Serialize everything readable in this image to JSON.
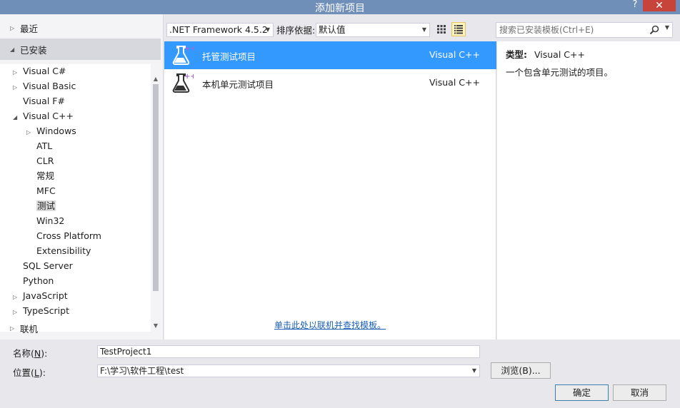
{
  "window": {
    "title": "添加新项目",
    "help_label": "?",
    "close_label": "✕"
  },
  "left": {
    "recent_label": "最近",
    "installed_label": "已安装",
    "online_label": "联机",
    "tree": [
      {
        "label": "Visual C#",
        "level": 0,
        "expander": "collapsed"
      },
      {
        "label": "Visual Basic",
        "level": 0,
        "expander": "collapsed"
      },
      {
        "label": "Visual F#",
        "level": 0,
        "expander": "none"
      },
      {
        "label": "Visual C++",
        "level": 0,
        "expander": "expanded"
      },
      {
        "label": "Windows",
        "level": 1,
        "expander": "collapsed"
      },
      {
        "label": "ATL",
        "level": 1,
        "expander": "none"
      },
      {
        "label": "CLR",
        "level": 1,
        "expander": "none"
      },
      {
        "label": "常规",
        "level": 1,
        "expander": "none"
      },
      {
        "label": "MFC",
        "level": 1,
        "expander": "none"
      },
      {
        "label": "测试",
        "level": 1,
        "expander": "none",
        "selected": true
      },
      {
        "label": "Win32",
        "level": 1,
        "expander": "none"
      },
      {
        "label": "Cross Platform",
        "level": 1,
        "expander": "none"
      },
      {
        "label": "Extensibility",
        "level": 1,
        "expander": "none"
      },
      {
        "label": "SQL Server",
        "level": 0,
        "expander": "none"
      },
      {
        "label": "Python",
        "level": 0,
        "expander": "none"
      },
      {
        "label": "JavaScript",
        "level": 0,
        "expander": "collapsed"
      },
      {
        "label": "TypeScript",
        "level": 0,
        "expander": "collapsed"
      }
    ]
  },
  "toolbar": {
    "framework": ".NET Framework 4.5.2",
    "sort_label": "排序依据:",
    "sort_value": "默认值",
    "search_placeholder": "搜索已安装模板(Ctrl+E)"
  },
  "templates": [
    {
      "name": "托管测试项目",
      "language": "Visual C++",
      "selected": true
    },
    {
      "name": "本机单元测试项目",
      "language": "Visual C++",
      "selected": false
    }
  ],
  "online_link": "单击此处以联机并查找模板。",
  "details": {
    "type_label": "类型:",
    "type_value": "Visual C++",
    "description": "一个包含单元测试的项目。"
  },
  "form": {
    "name_label": "名称(",
    "name_key": "N",
    "name_label_end": "):",
    "name_value": "TestProject1",
    "location_label": "位置(",
    "location_key": "L",
    "location_label_end": "):",
    "location_value": "F:\\学习\\软件工程\\test",
    "browse_label": "浏览(B)...",
    "ok_label": "确定",
    "cancel_label": "取消"
  },
  "colors": {
    "accent": "#3399ff",
    "titlebar": "#6f8fb8",
    "close": "#c7443a",
    "link": "#1a5fb4"
  }
}
